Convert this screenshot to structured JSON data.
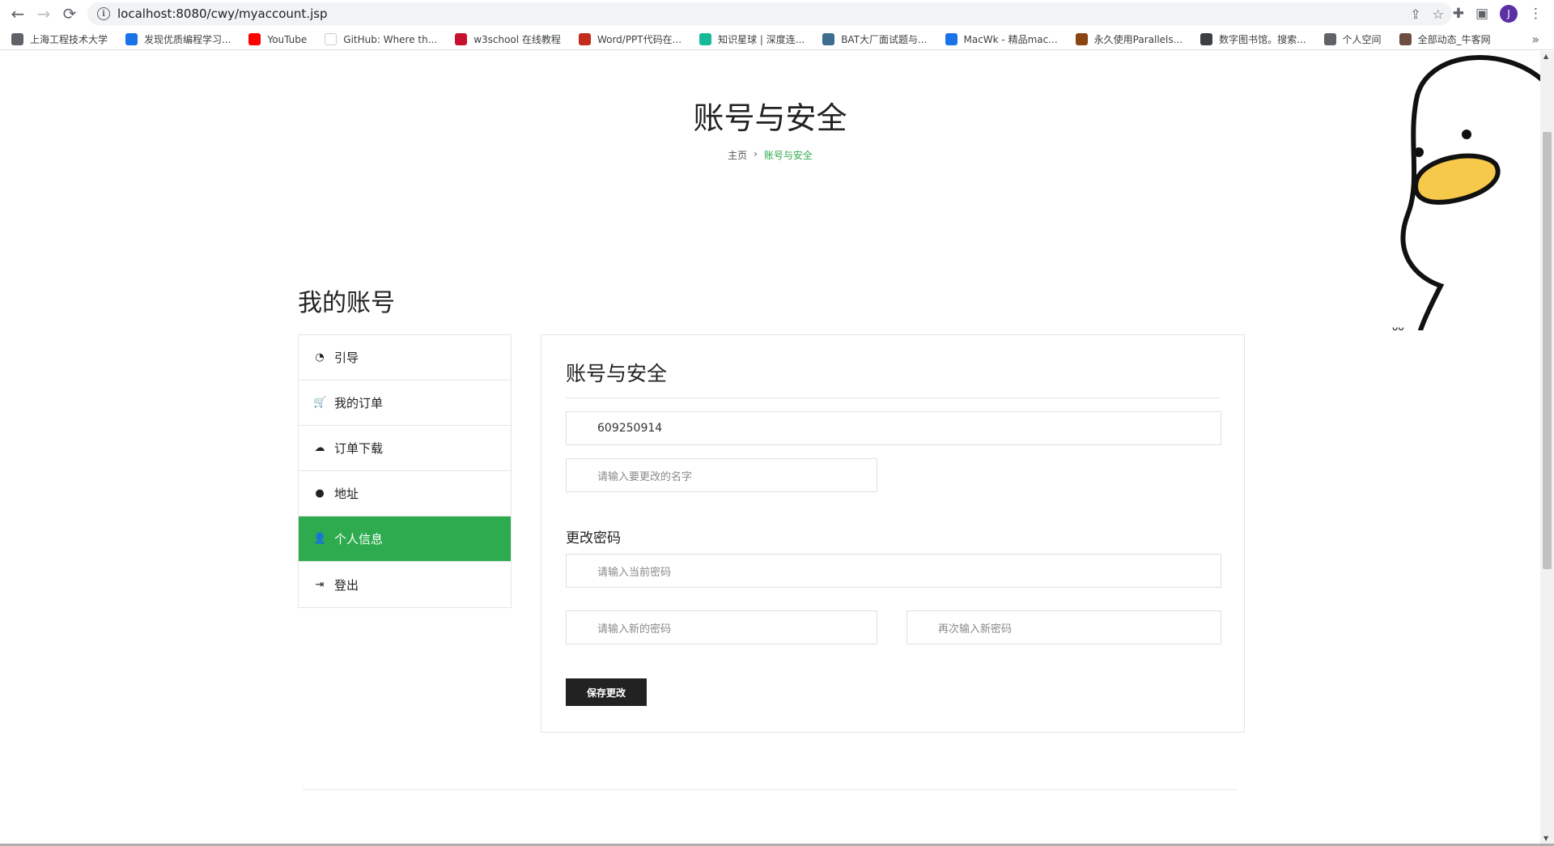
{
  "browser": {
    "url": "localhost:8080/cwy/myaccount.jsp",
    "profile_initial": "J",
    "bookmarks": [
      {
        "label": "上海工程技术大学",
        "icon": "globe-icon",
        "color": "#5f6368"
      },
      {
        "label": "发现优质编程学习...",
        "icon": "code-icon",
        "color": "#1a73e8"
      },
      {
        "label": "YouTube",
        "icon": "youtube-icon",
        "color": "#ff0000"
      },
      {
        "label": "GitHub: Where th...",
        "icon": "github-icon",
        "color": "#ffffff"
      },
      {
        "label": "w3school 在线教程",
        "icon": "w3school-icon",
        "color": "#c8102e"
      },
      {
        "label": "Word/PPT代码在...",
        "icon": "word-icon",
        "color": "#c42b1c"
      },
      {
        "label": "知识星球 | 深度连...",
        "icon": "zsxq-icon",
        "color": "#16b998"
      },
      {
        "label": "BAT大厂面试题与...",
        "icon": "bat-icon",
        "color": "#3c6e8f"
      },
      {
        "label": "MacWk - 精品mac...",
        "icon": "macwk-icon",
        "color": "#1a73e8"
      },
      {
        "label": "永久使用Parallels...",
        "icon": "parallels-icon",
        "color": "#8b4513"
      },
      {
        "label": "数字图书馆。搜索...",
        "icon": "library-icon",
        "color": "#3c4043"
      },
      {
        "label": "个人空间",
        "icon": "globe-icon",
        "color": "#5f6368"
      },
      {
        "label": "全部动态_牛客网",
        "icon": "nowcoder-icon",
        "color": "#6d4c41"
      }
    ]
  },
  "page": {
    "title": "账号与安全",
    "breadcrumb": {
      "home": "主页",
      "separator": "›",
      "current": "账号与安全"
    },
    "section_title": "我的账号"
  },
  "sidebar": {
    "items": [
      {
        "label": "引导",
        "icon": "dashboard-icon",
        "glyph": "◔"
      },
      {
        "label": "我的订单",
        "icon": "cart-icon",
        "glyph": "🛒"
      },
      {
        "label": "订单下载",
        "icon": "cloud-download-icon",
        "glyph": "☁"
      },
      {
        "label": "地址",
        "icon": "map-marker-icon",
        "glyph": "●"
      },
      {
        "label": "个人信息",
        "icon": "user-icon",
        "glyph": "👤"
      },
      {
        "label": "登出",
        "icon": "sign-out-icon",
        "glyph": "⇥"
      }
    ],
    "active": "个人信息"
  },
  "panel": {
    "title": "账号与安全",
    "account_value": "609250914",
    "name_placeholder": "请输入要更改的名字",
    "password_section": "更改密码",
    "current_password_placeholder": "请输入当前密码",
    "new_password_placeholder": "请输入新的密码",
    "confirm_password_placeholder": "再次输入新密码",
    "save_label": "保存更改"
  },
  "colors": {
    "accent": "#2eab4f",
    "button": "#222222"
  }
}
